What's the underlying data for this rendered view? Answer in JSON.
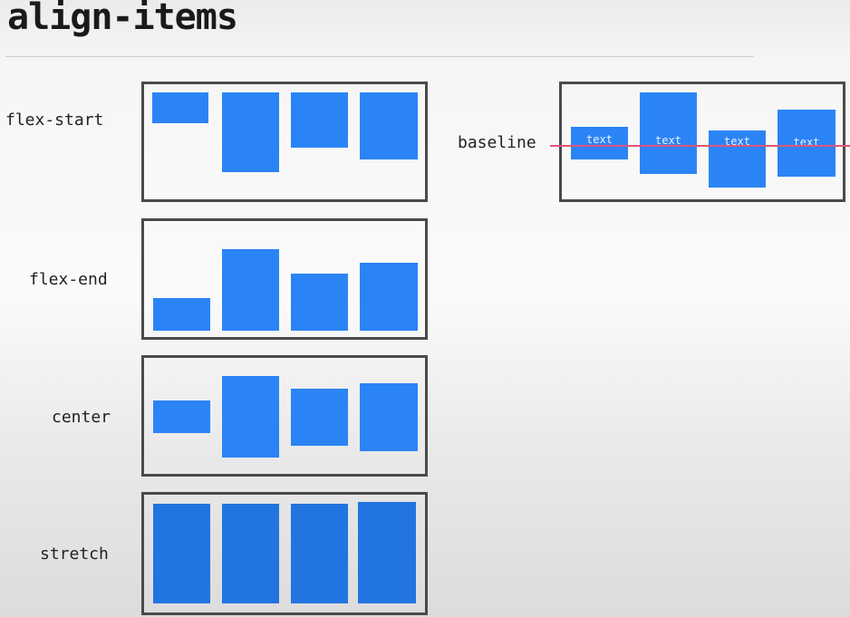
{
  "title": "align-items",
  "accent_color": "#2b84f5",
  "baseline_line_color": "#e0557a",
  "demos": {
    "flex_start": {
      "label": "flex-start"
    },
    "flex_end": {
      "label": "flex-end"
    },
    "center": {
      "label": "center"
    },
    "stretch": {
      "label": "stretch"
    },
    "baseline": {
      "label": "baseline",
      "box_text": [
        "text",
        "text",
        "text",
        "text"
      ]
    }
  }
}
